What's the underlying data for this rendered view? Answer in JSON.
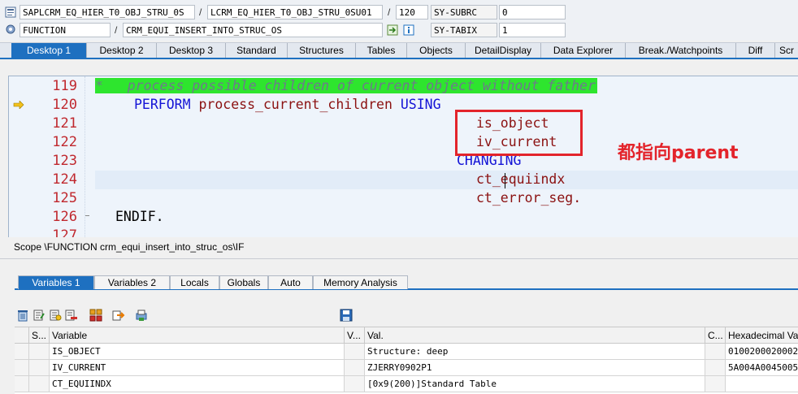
{
  "infobar": {
    "row1": {
      "program": "SAPLCRM_EQ_HIER_T0_OBJ_STRU_0S",
      "include": "LCRM_EQ_HIER_T0_OBJ_STRU_0SU01",
      "line": "120",
      "sysfield_name": "SY-SUBRC",
      "sysfield_value": "0"
    },
    "row2": {
      "type": "FUNCTION",
      "name": "CRM_EQUI_INSERT_INTO_STRUC_OS",
      "sysfield_name": "SY-TABIX",
      "sysfield_value": "1"
    },
    "separator": "/"
  },
  "desktop_tabs": [
    "Desktop 1",
    "Desktop 2",
    "Desktop 3",
    "Standard",
    "Structures",
    "Tables",
    "Objects",
    "DetailDisplay",
    "Data Explorer",
    "Break./Watchpoints",
    "Diff",
    "Scr"
  ],
  "code": {
    "lines": [
      {
        "num": "119",
        "kind": "comment",
        "text": "*   process possible children of current object without father"
      },
      {
        "num": "120",
        "kind": "perform",
        "kw": "PERFORM",
        "name": "process_current_children",
        "kw2": "USING"
      },
      {
        "num": "121",
        "kind": "param",
        "text": "is_object"
      },
      {
        "num": "122",
        "kind": "param",
        "text": "iv_current"
      },
      {
        "num": "123",
        "kind": "kw",
        "text": "CHANGING"
      },
      {
        "num": "124",
        "kind": "param",
        "text": "ct_equiindx"
      },
      {
        "num": "125",
        "kind": "param",
        "text": "ct_error_seg."
      },
      {
        "num": "126",
        "kind": "endif",
        "text": "ENDIF."
      },
      {
        "num": "127",
        "kind": "empty",
        "text": ""
      }
    ],
    "current_line": "120",
    "comment_bg": "#2ee52e",
    "annotation": "都指向parent",
    "annotation_color": "#e3242b"
  },
  "scope": "Scope \\FUNCTION crm_equi_insert_into_struc_os\\IF",
  "variable_tabs": [
    "Variables 1",
    "Variables 2",
    "Locals",
    "Globals",
    "Auto",
    "Memory Analysis"
  ],
  "toolbar_icons": [
    "trash-icon",
    "edit-icon",
    "display-icon",
    "delete-row-icon",
    "sort-icon",
    "export-icon",
    "print-icon",
    "save-icon"
  ],
  "table": {
    "headers": {
      "s": "S...",
      "variable": "Variable",
      "v": "V...",
      "val": "Val.",
      "c": "C...",
      "hex": "Hexadecimal Va"
    },
    "rows": [
      {
        "variable": "IS_OBJECT",
        "value": "Structure: deep",
        "hex": "0100200020002"
      },
      {
        "variable": "IV_CURRENT",
        "value": "ZJERRY0902P1",
        "hex": "5A004A0045005"
      },
      {
        "variable": "CT_EQUIINDX",
        "value": "[0x9(200)]Standard Table",
        "hex": ""
      }
    ]
  }
}
